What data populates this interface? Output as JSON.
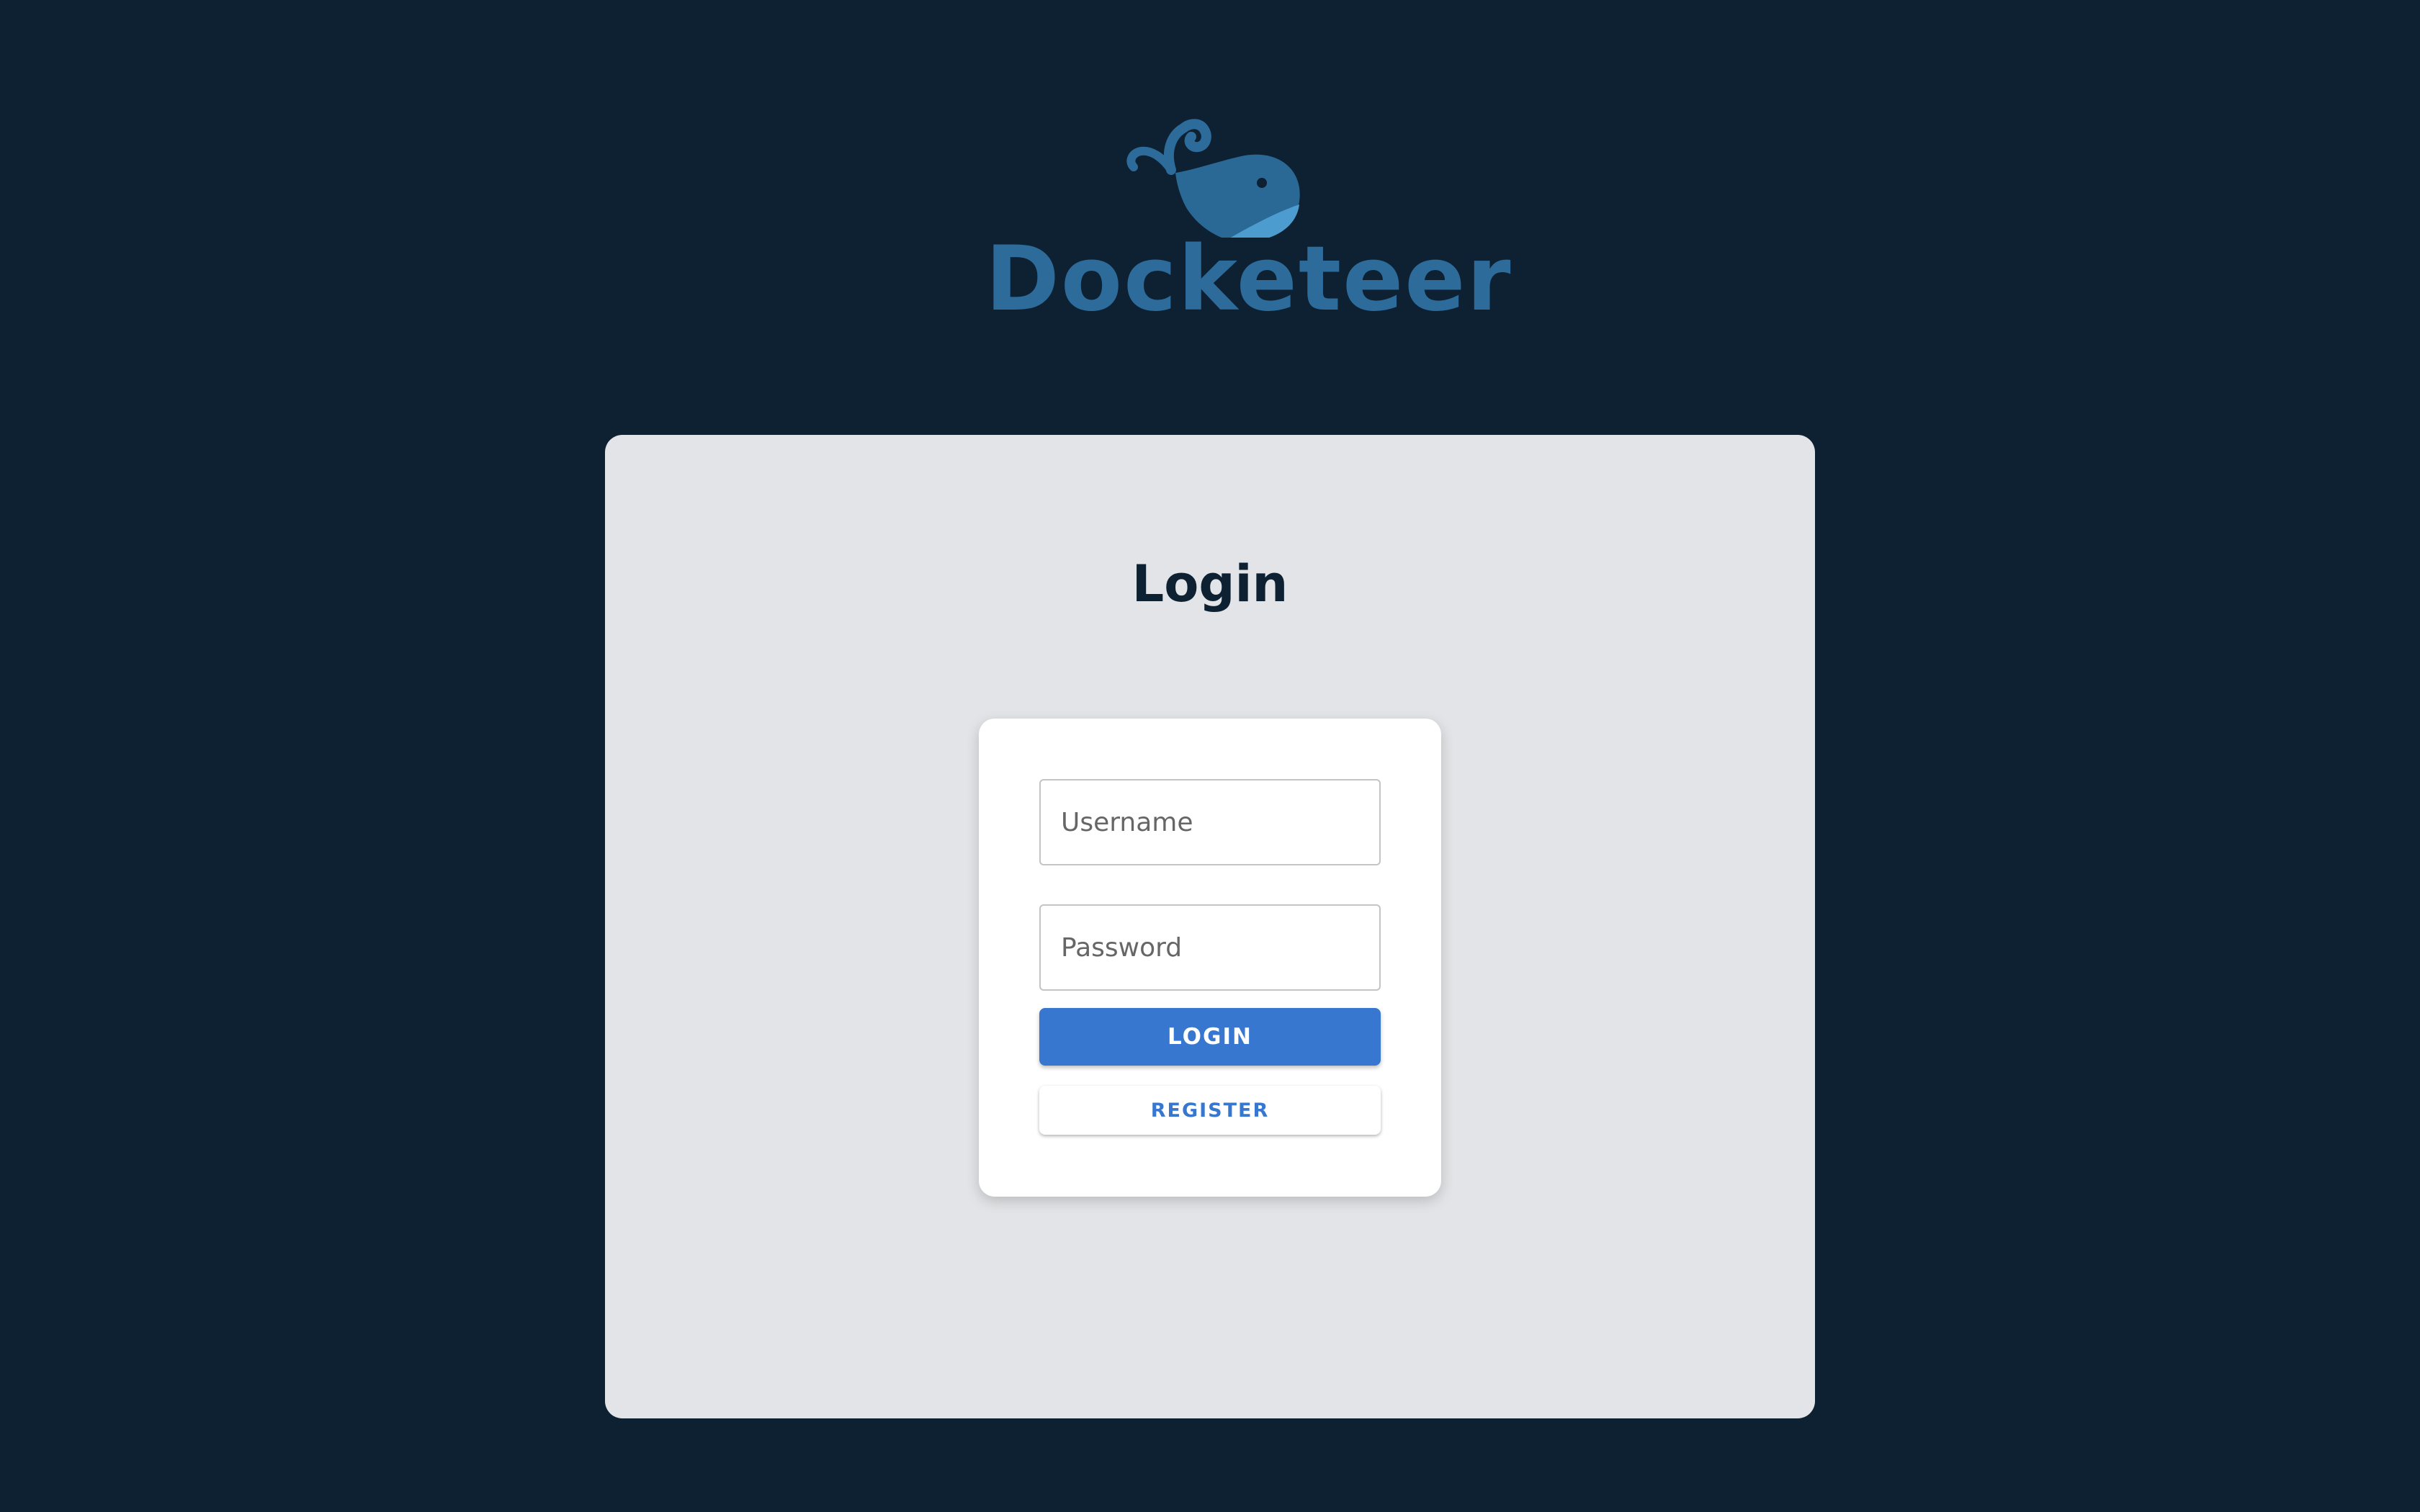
{
  "brand": {
    "name": "Docketeer",
    "logo_icon": "whale-icon",
    "color": "#2d6b9b"
  },
  "login": {
    "title": "Login",
    "username_placeholder": "Username",
    "password_placeholder": "Password",
    "login_label": "LOGIN",
    "register_label": "REGISTER"
  },
  "colors": {
    "background": "#0d2132",
    "panel": "#e2e4e7",
    "accent": "#3777d0"
  }
}
